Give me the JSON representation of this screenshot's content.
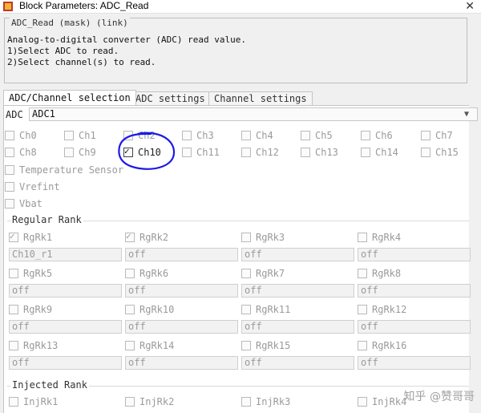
{
  "window": {
    "title": "Block Parameters: ADC_Read",
    "close_glyph": "✕"
  },
  "mask": {
    "header": "ADC_Read (mask) (link)",
    "lines": [
      "Analog-to-digital converter (ADC) read value.",
      "1)Select ADC to read.",
      "2)Select channel(s) to read."
    ]
  },
  "tabs": [
    {
      "label": "ADC/Channel selection",
      "active": true
    },
    {
      "label": "ADC settings",
      "active": false
    },
    {
      "label": "Channel settings",
      "active": false
    }
  ],
  "adc": {
    "label": "ADC",
    "value": "ADC1"
  },
  "channels": [
    {
      "label": "Ch0",
      "checked": false
    },
    {
      "label": "Ch1",
      "checked": false
    },
    {
      "label": "Ch2",
      "checked": false
    },
    {
      "label": "Ch3",
      "checked": false
    },
    {
      "label": "Ch4",
      "checked": false
    },
    {
      "label": "Ch5",
      "checked": false
    },
    {
      "label": "Ch6",
      "checked": false
    },
    {
      "label": "Ch7",
      "checked": false
    },
    {
      "label": "Ch8",
      "checked": false
    },
    {
      "label": "Ch9",
      "checked": false
    },
    {
      "label": "Ch10",
      "checked": true
    },
    {
      "label": "Ch11",
      "checked": false
    },
    {
      "label": "Ch12",
      "checked": false
    },
    {
      "label": "Ch13",
      "checked": false
    },
    {
      "label": "Ch14",
      "checked": false
    },
    {
      "label": "Ch15",
      "checked": false
    }
  ],
  "extras": [
    {
      "label": "Temperature Sensor",
      "checked": false
    },
    {
      "label": "Vrefint",
      "checked": false
    },
    {
      "label": "Vbat",
      "checked": false
    }
  ],
  "regular": {
    "label": "Regular Rank",
    "items": [
      {
        "label": "RgRk1",
        "checked": true,
        "value": "Ch10_r1"
      },
      {
        "label": "RgRk2",
        "checked": true,
        "value": "off"
      },
      {
        "label": "RgRk3",
        "checked": false,
        "value": "off"
      },
      {
        "label": "RgRk4",
        "checked": false,
        "value": "off"
      },
      {
        "label": "RgRk5",
        "checked": false,
        "value": "off"
      },
      {
        "label": "RgRk6",
        "checked": false,
        "value": "off"
      },
      {
        "label": "RgRk7",
        "checked": false,
        "value": "off"
      },
      {
        "label": "RgRk8",
        "checked": false,
        "value": "off"
      },
      {
        "label": "RgRk9",
        "checked": false,
        "value": "off"
      },
      {
        "label": "RgRk10",
        "checked": false,
        "value": "off"
      },
      {
        "label": "RgRk11",
        "checked": false,
        "value": "off"
      },
      {
        "label": "RgRk12",
        "checked": false,
        "value": "off"
      },
      {
        "label": "RgRk13",
        "checked": false,
        "value": "off"
      },
      {
        "label": "RgRk14",
        "checked": false,
        "value": "off"
      },
      {
        "label": "RgRk15",
        "checked": false,
        "value": "off"
      },
      {
        "label": "RgRk16",
        "checked": false,
        "value": "off"
      }
    ]
  },
  "injected": {
    "label": "Injected Rank",
    "items": [
      {
        "label": "InjRk1",
        "checked": false
      },
      {
        "label": "InjRk2",
        "checked": false
      },
      {
        "label": "InjRk3",
        "checked": false
      },
      {
        "label": "InjRk4",
        "checked": false
      }
    ]
  },
  "watermark": "知乎 @赞哥哥",
  "colors": {
    "annotation": "#1a1ae6"
  }
}
